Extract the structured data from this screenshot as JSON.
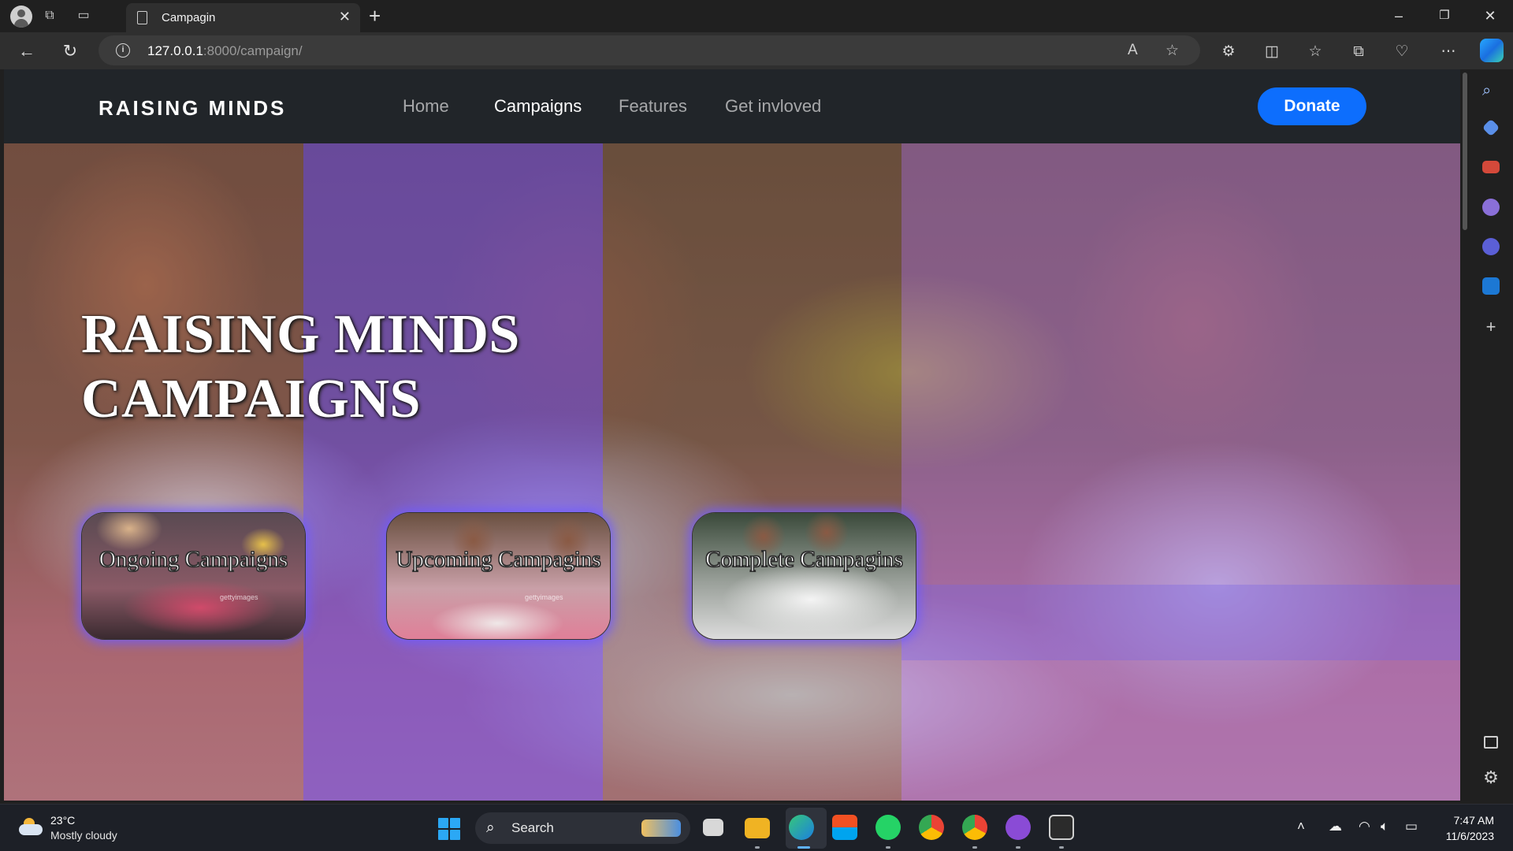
{
  "browser": {
    "tab_title": "Campagin",
    "url_host": "127.0.0.1",
    "url_rest": ":8000/campaign/"
  },
  "nav": {
    "brand": "RAISING MINDS",
    "links": [
      "Home",
      "Campaigns",
      "Features",
      "Get invloved"
    ],
    "active": "Campaigns",
    "donate": "Donate"
  },
  "hero": {
    "title_line1": "RAISING MINDS",
    "title_line2": "CAMPAIGNS"
  },
  "cards": [
    {
      "label": "Ongoing Campaigns",
      "watermark": "gettyimages"
    },
    {
      "label": "Upcoming Campagins",
      "watermark": "gettyimages"
    },
    {
      "label": "Complete Campagins"
    }
  ],
  "taskbar": {
    "temperature": "23°C",
    "weather": "Mostly cloudy",
    "search_label": "Search",
    "time": "7:47 AM",
    "date": "11/6/2023"
  },
  "colors": {
    "navbar_bg": "#212529",
    "donate_bg": "#0d6efd",
    "overlay_purple": "#5a3ce6"
  }
}
